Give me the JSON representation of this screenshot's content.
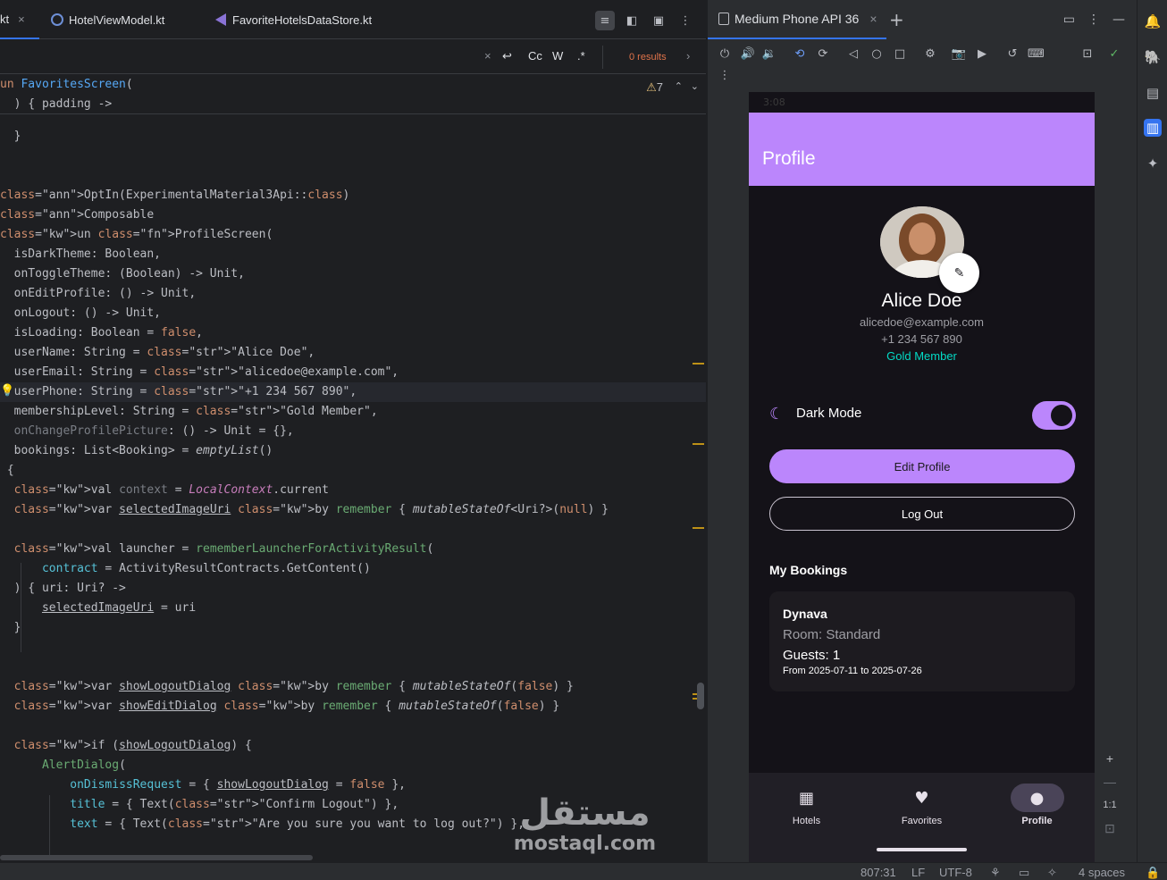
{
  "editor": {
    "tabs": [
      {
        "label": "kt",
        "active": true
      },
      {
        "label": "HotelViewModel.kt"
      },
      {
        "label": "FavoriteHotelsDataStore.kt"
      }
    ],
    "find": {
      "case_label": "Cc",
      "word_label": "W",
      "regex_label": ".*",
      "results": "0 results"
    },
    "warnings": "7",
    "sticky": [
      "un FavoritesScreen(",
      "  ) { padding ->"
    ]
  },
  "code_lines": [
    "  }",
    "",
    "",
    "OptIn(ExperimentalMaterial3Api::class)",
    "Composable",
    "un ProfileScreen(",
    "  isDarkTheme: Boolean,",
    "  onToggleTheme: (Boolean) -> Unit,",
    "  onEditProfile: () -> Unit,",
    "  onLogout: () -> Unit,",
    "  isLoading: Boolean = false,",
    "  userName: String = \"Alice Doe\",",
    "  userEmail: String = \"alicedoe@example.com\",",
    "  userPhone: String = \"+1 234 567 890\",",
    "  membershipLevel: String = \"Gold Member\",",
    "  onChangeProfilePicture: () -> Unit = {},",
    "  bookings: List<Booking> = emptyList()",
    " {",
    "  val context = LocalContext.current",
    "  var selectedImageUri by remember { mutableStateOf<Uri?>(null) }",
    "",
    "  val launcher = rememberLauncherForActivityResult(",
    "      contract = ActivityResultContracts.GetContent()",
    "  ) { uri: Uri? ->",
    "      selectedImageUri = uri",
    "  }",
    "",
    "",
    "  var showLogoutDialog by remember { mutableStateOf(false) }",
    "  var showEditDialog by remember { mutableStateOf(false) }",
    "",
    "  if (showLogoutDialog) {",
    "      AlertDialog(",
    "          onDismissRequest = { showLogoutDialog = false },",
    "          title = { Text(\"Confirm Logout\") },",
    "          text = { Text(\"Are you sure you want to log out?\") },"
  ],
  "device": {
    "tab_label": "Medium Phone API 36",
    "statusbar_time": "3:08"
  },
  "app": {
    "title": "Profile",
    "user_name": "Alice Doe",
    "user_email": "alicedoe@example.com",
    "user_phone": "+1 234 567 890",
    "membership": "Gold Member",
    "dark_mode_label": "Dark Mode",
    "dark_mode_on": true,
    "edit_profile_label": "Edit Profile",
    "logout_label": "Log Out",
    "bookings_title": "My Bookings",
    "booking": {
      "hotel": "Dynava",
      "room": "Room: Standard",
      "guests": "Guests: 1",
      "dates": "From 2025-07-11 to 2025-07-26"
    },
    "nav": [
      {
        "label": "Hotels",
        "icon": "hotel-icon"
      },
      {
        "label": "Favorites",
        "icon": "heart-icon"
      },
      {
        "label": "Profile",
        "icon": "person-icon",
        "active": true
      }
    ]
  },
  "zoom": {
    "ratio_label": "1:1"
  },
  "status": {
    "position": "807:31",
    "line_sep": "LF",
    "encoding": "UTF-8",
    "indent": "4 spaces"
  },
  "watermark": {
    "arabic": "مستقل",
    "latin": "mostaql.com"
  },
  "colors": {
    "accent": "#bb86fc",
    "member": "#03dac5",
    "ide_bg": "#1e1f22",
    "selection": "#3574f0"
  }
}
